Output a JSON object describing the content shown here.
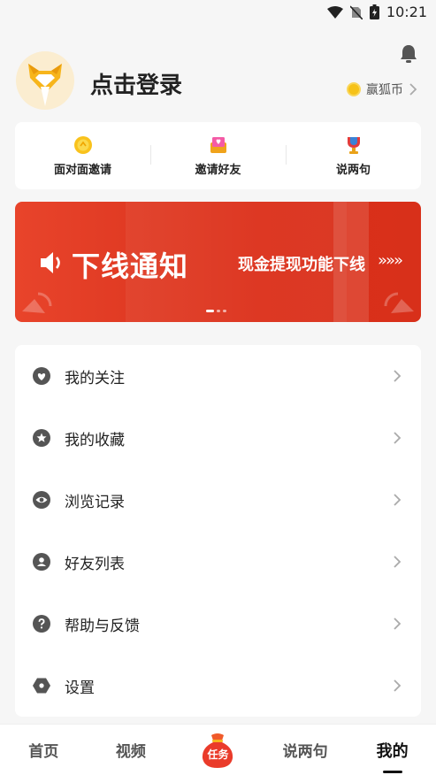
{
  "status": {
    "time": "10:21"
  },
  "header": {
    "login_text": "点击登录",
    "coins_label": "赢狐币"
  },
  "quick": [
    {
      "label": "面对面邀请",
      "icon": "coin-icon"
    },
    {
      "label": "邀请好友",
      "icon": "gift-heart-icon"
    },
    {
      "label": "说两句",
      "icon": "trophy-icon"
    }
  ],
  "banner": {
    "title": "下线通知",
    "subtitle": "现金提现功能下线",
    "arrows": "»»»"
  },
  "menu": [
    {
      "label": "我的关注",
      "icon": "heart-icon"
    },
    {
      "label": "我的收藏",
      "icon": "star-icon"
    },
    {
      "label": "浏览记录",
      "icon": "eye-icon"
    },
    {
      "label": "好友列表",
      "icon": "person-icon"
    },
    {
      "label": "帮助与反馈",
      "icon": "help-icon"
    },
    {
      "label": "设置",
      "icon": "settings-icon"
    }
  ],
  "tabs": [
    {
      "label": "首页"
    },
    {
      "label": "视频"
    },
    {
      "label": "任务"
    },
    {
      "label": "说两句"
    },
    {
      "label": "我的"
    }
  ],
  "colors": {
    "accent": "#e03a23",
    "coin": "#f6c218"
  }
}
